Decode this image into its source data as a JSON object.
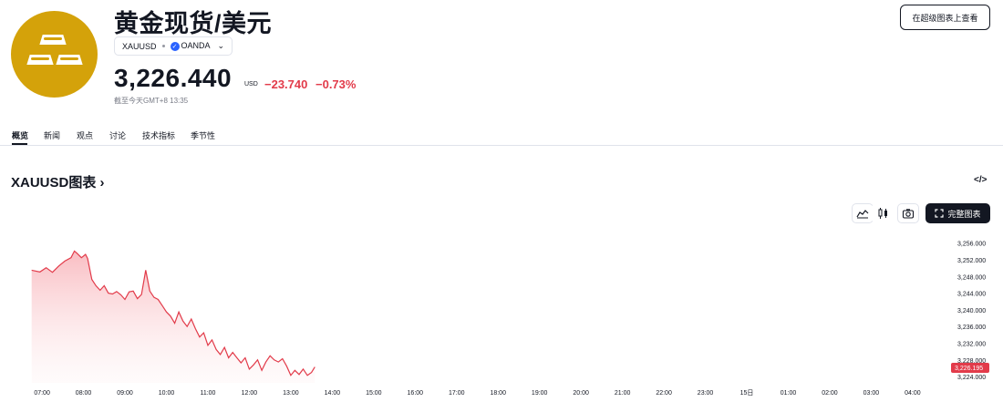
{
  "header": {
    "title": "黄金现货/美元",
    "symbol": "XAUUSD",
    "source": "OANDA",
    "price": "3,226.440",
    "currency": "USD",
    "change": "−23.740",
    "change_pct": "−0.73%",
    "as_of": "截至今天GMT+8 13:35",
    "super_chart_button": "在超级图表上查看"
  },
  "tabs": [
    {
      "label": "概览",
      "active": true
    },
    {
      "label": "新闻",
      "active": false
    },
    {
      "label": "观点",
      "active": false
    },
    {
      "label": "讨论",
      "active": false
    },
    {
      "label": "技术指标",
      "active": false
    },
    {
      "label": "季节性",
      "active": false
    }
  ],
  "chart_section": {
    "title": "XAUUSD图表",
    "title_chevron": "›",
    "embed_icon_text": "</>",
    "toolbar": {
      "area_icon": "area-chart-icon",
      "candles_icon": "candlestick-icon",
      "camera_icon": "camera-icon",
      "full_chart_button": "完整图表"
    }
  },
  "colors": {
    "accent_red": "#e23b4a",
    "logo_gold": "#d4a20a",
    "text": "#131722",
    "muted": "#787b86"
  },
  "chart_data": {
    "type": "area",
    "series": [
      {
        "values": [
          [
            6.75,
            3249.6
          ],
          [
            6.95,
            3249.2
          ],
          [
            7.1,
            3250.2
          ],
          [
            7.25,
            3249.1
          ],
          [
            7.4,
            3250.6
          ],
          [
            7.55,
            3251.8
          ],
          [
            7.7,
            3252.6
          ],
          [
            7.78,
            3254.2
          ],
          [
            7.85,
            3253.6
          ],
          [
            7.95,
            3252.6
          ],
          [
            8.05,
            3253.4
          ],
          [
            8.1,
            3252.4
          ],
          [
            8.2,
            3247.4
          ],
          [
            8.3,
            3245.9
          ],
          [
            8.4,
            3244.8
          ],
          [
            8.5,
            3245.9
          ],
          [
            8.6,
            3244.1
          ],
          [
            8.7,
            3243.9
          ],
          [
            8.8,
            3244.5
          ],
          [
            8.9,
            3243.7
          ],
          [
            9.0,
            3242.6
          ],
          [
            9.1,
            3244.4
          ],
          [
            9.2,
            3244.6
          ],
          [
            9.3,
            3242.8
          ],
          [
            9.4,
            3243.8
          ],
          [
            9.5,
            3249.6
          ],
          [
            9.6,
            3244.6
          ],
          [
            9.7,
            3243.1
          ],
          [
            9.8,
            3242.6
          ],
          [
            9.9,
            3241.1
          ],
          [
            10.0,
            3239.6
          ],
          [
            10.1,
            3238.6
          ],
          [
            10.2,
            3236.9
          ],
          [
            10.3,
            3239.6
          ],
          [
            10.4,
            3237.4
          ],
          [
            10.5,
            3236.1
          ],
          [
            10.6,
            3237.9
          ],
          [
            10.7,
            3235.6
          ],
          [
            10.8,
            3233.6
          ],
          [
            10.9,
            3234.6
          ],
          [
            11.0,
            3231.6
          ],
          [
            11.1,
            3232.9
          ],
          [
            11.2,
            3230.6
          ],
          [
            11.3,
            3229.4
          ],
          [
            11.4,
            3231.1
          ],
          [
            11.5,
            3228.6
          ],
          [
            11.6,
            3229.9
          ],
          [
            11.7,
            3228.6
          ],
          [
            11.8,
            3227.4
          ],
          [
            11.9,
            3228.6
          ],
          [
            12.0,
            3225.9
          ],
          [
            12.1,
            3226.9
          ],
          [
            12.2,
            3228.1
          ],
          [
            12.3,
            3225.6
          ],
          [
            12.4,
            3227.6
          ],
          [
            12.5,
            3229.1
          ],
          [
            12.6,
            3228.1
          ],
          [
            12.7,
            3227.6
          ],
          [
            12.8,
            3228.4
          ],
          [
            12.9,
            3226.6
          ],
          [
            13.0,
            3224.4
          ],
          [
            13.1,
            3225.6
          ],
          [
            13.2,
            3224.6
          ],
          [
            13.3,
            3225.9
          ],
          [
            13.4,
            3224.4
          ],
          [
            13.5,
            3225.1
          ],
          [
            13.58,
            3226.4
          ]
        ]
      }
    ],
    "x_ticks": [
      "07:00",
      "08:00",
      "09:00",
      "10:00",
      "11:00",
      "12:00",
      "13:00",
      "14:00",
      "15:00",
      "16:00",
      "17:00",
      "18:00",
      "19:00",
      "20:00",
      "21:00",
      "22:00",
      "23:00",
      "15日",
      "01:00",
      "02:00",
      "03:00",
      "04:00"
    ],
    "y_ticks": [
      "3,256.000",
      "3,252.000",
      "3,248.000",
      "3,244.000",
      "3,240.000",
      "3,236.000",
      "3,232.000",
      "3,228.000",
      "3,224.000"
    ],
    "last_price_label": "3,226.195",
    "y_range": [
      3222.6,
      3258.0
    ],
    "x_range": [
      6.25,
      28.75
    ],
    "line_color": "#e23b4a",
    "grid": false
  }
}
